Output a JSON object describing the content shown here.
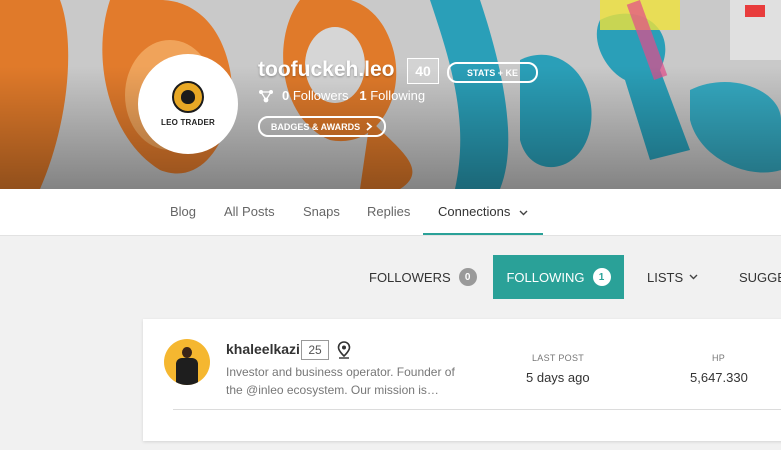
{
  "profile": {
    "username": "toofuckeh.leo",
    "reputation": "40",
    "stats_button": "STATS + KE",
    "followers_count": "0",
    "followers_label": "Followers",
    "following_count": "1",
    "following_label": "Following",
    "badges_button": "BADGES & AWARDS",
    "avatar_text": "LEO TRADER"
  },
  "nav": {
    "tabs": [
      {
        "label": "Blog"
      },
      {
        "label": "All Posts"
      },
      {
        "label": "Snaps"
      },
      {
        "label": "Replies"
      },
      {
        "label": "Connections"
      }
    ],
    "active": "Connections"
  },
  "subtabs": {
    "followers_label": "FOLLOWERS",
    "followers_count": "0",
    "following_label": "FOLLOWING",
    "following_count": "1",
    "lists_label": "LISTS",
    "suggest_label": "SUGGE"
  },
  "entry": {
    "username": "khaleelkazi",
    "reputation": "25",
    "bio": "Investor and business operator. Founder of the @inleo ecosystem. Our mission is…",
    "last_post_label": "LAST POST",
    "last_post_value": "5 days ago",
    "hp_label": "HP",
    "hp_value": "5,647.330"
  },
  "colors": {
    "accent": "#2aa198",
    "banner_orange": "#e07a2a",
    "banner_blue": "#2a9fb8"
  },
  "icons": [
    "network-icon",
    "chevron-right-icon",
    "chevron-down-icon",
    "location-pin-icon"
  ]
}
